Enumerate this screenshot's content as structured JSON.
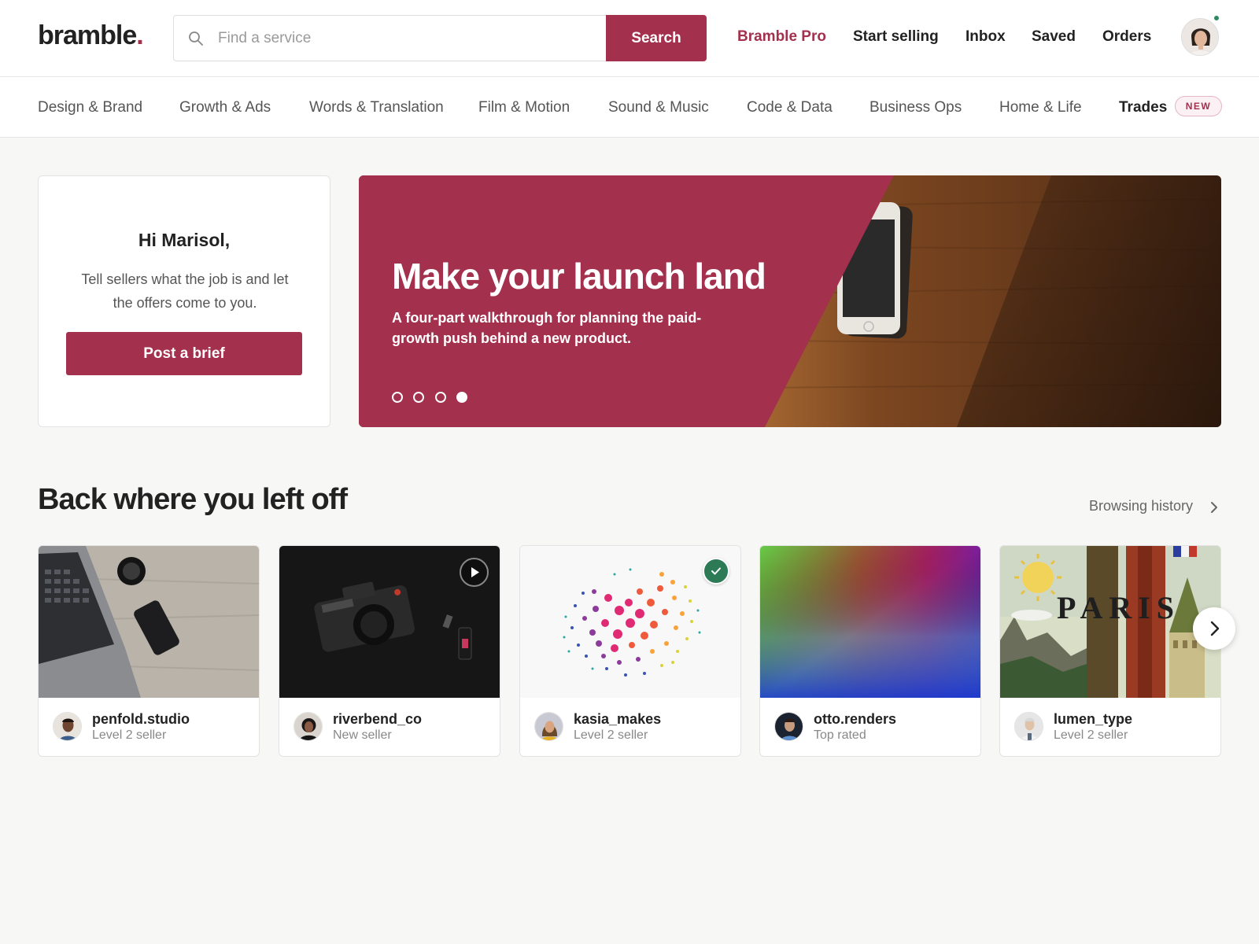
{
  "header": {
    "logo_text": "bramble",
    "logo_dot": ".",
    "search": {
      "placeholder": "Find a service",
      "value": "",
      "button_label": "Search"
    },
    "nav": [
      "Bramble Pro",
      "Start selling",
      "Inbox",
      "Saved",
      "Orders"
    ],
    "brand_color": "#a3304d",
    "online_status_color": "#2d8a5e"
  },
  "categories": {
    "items": [
      "Design & Brand",
      "Growth & Ads",
      "Words & Translation",
      "Film & Motion",
      "Sound & Music",
      "Code & Data",
      "Business Ops",
      "Home & Life",
      "Trades"
    ],
    "new_badge": "NEW"
  },
  "welcome": {
    "title": "Hi Marisol,",
    "text": "Tell sellers what the job is and let the offers come to you.",
    "button_label": "Post a brief"
  },
  "hero": {
    "title": "Make your launch land",
    "subtitle": "A four-part walkthrough for planning the paid-growth push behind a new product.",
    "slide_count": 4,
    "active_slide": 4
  },
  "recent": {
    "title": "Back where you left off",
    "link_label": "Browsing history",
    "cards": [
      {
        "seller": "penfold.studio",
        "level": "Level 2 seller",
        "thumb": "laptop-desk-image"
      },
      {
        "seller": "riverbend_co",
        "level": "New seller",
        "thumb": "camera-image",
        "badge": "play-icon"
      },
      {
        "seller": "kasia_makes",
        "level": "Level 2 seller",
        "thumb": "dot-pattern-image",
        "badge": "check-icon"
      },
      {
        "seller": "otto.renders",
        "level": "Top rated",
        "thumb": "gradient-image"
      },
      {
        "seller": "lumen_type",
        "level": "Level 2 seller",
        "thumb": "paris-poster-image"
      }
    ],
    "poster_text": "PARIS"
  }
}
